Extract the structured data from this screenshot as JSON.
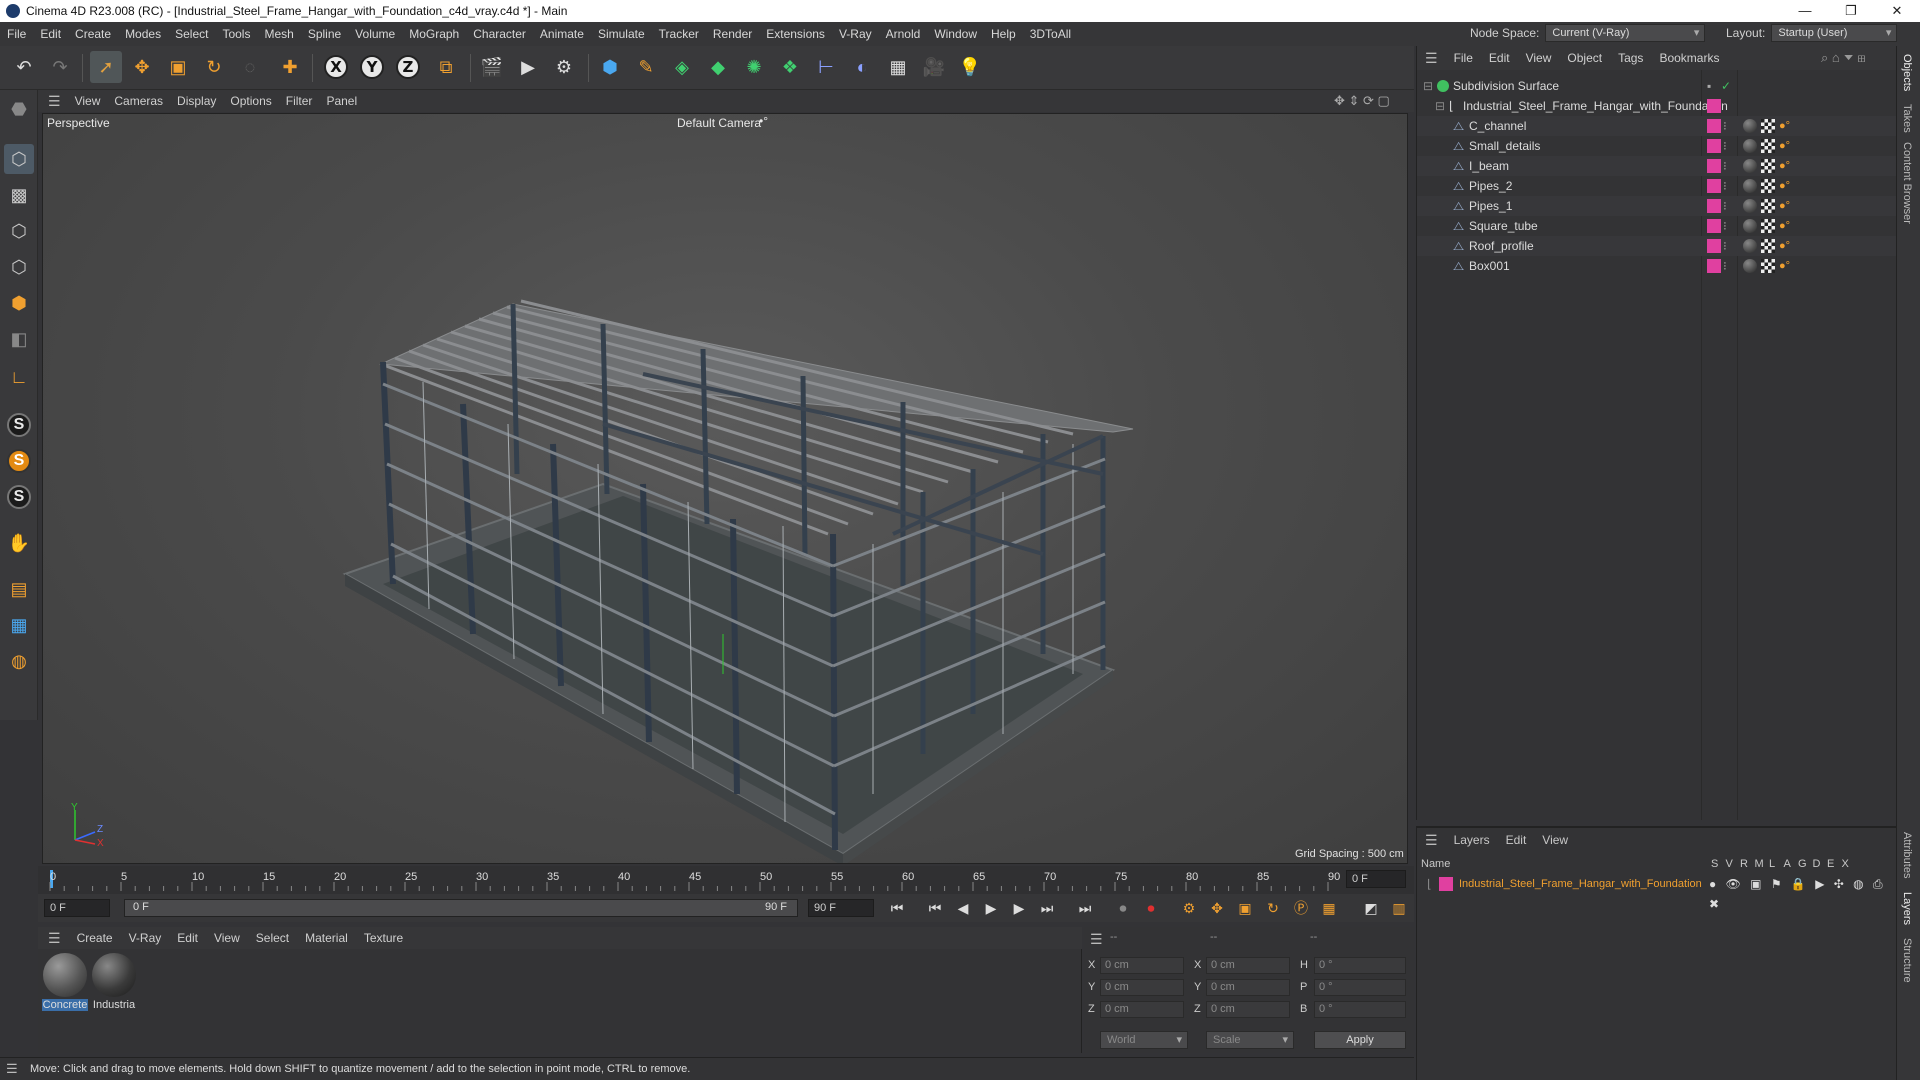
{
  "window": {
    "title": "Cinema 4D R23.008 (RC) - [Industrial_Steel_Frame_Hangar_with_Foundation_c4d_vray.c4d *] - Main",
    "controls": [
      "—",
      "❐",
      "✕"
    ]
  },
  "menubar": {
    "items": [
      "File",
      "Edit",
      "Create",
      "Modes",
      "Select",
      "Tools",
      "Mesh",
      "Spline",
      "Volume",
      "MoGraph",
      "Character",
      "Animate",
      "Simulate",
      "Tracker",
      "Render",
      "Extensions",
      "V-Ray",
      "Arnold",
      "Window",
      "Help",
      "3DToAll"
    ],
    "node_space_label": "Node Space:",
    "node_space_value": "Current (V-Ray)",
    "layout_label": "Layout:",
    "layout_value": "Startup (User)"
  },
  "toolbar": {
    "axis_x": "X",
    "axis_y": "Y",
    "axis_z": "Z"
  },
  "left_tools": {
    "s_labels": [
      "S",
      "S",
      "S"
    ]
  },
  "viewport": {
    "menu": [
      "View",
      "Cameras",
      "Display",
      "Options",
      "Filter",
      "Panel"
    ],
    "view_name": "Perspective",
    "camera": "Default Camera",
    "camera_icon": "•°",
    "grid_spacing": "Grid Spacing : 500 cm",
    "axis_labels": {
      "y": "Y",
      "z": "Z",
      "x": "X"
    }
  },
  "timeline": {
    "ticks": [
      "0",
      "5",
      "10",
      "15",
      "20",
      "25",
      "30",
      "35",
      "40",
      "45",
      "50",
      "55",
      "60",
      "65",
      "70",
      "75",
      "80",
      "85",
      "90"
    ],
    "current_frame": "0 F",
    "start_field": "0 F",
    "range_start": "0 F",
    "range_end": "90 F",
    "end_field": "90 F"
  },
  "material_manager": {
    "menu": [
      "Create",
      "V-Ray",
      "Edit",
      "View",
      "Select",
      "Material",
      "Texture"
    ],
    "materials": [
      {
        "name": "Concrete"
      },
      {
        "name": "Industria"
      }
    ]
  },
  "coordinates": {
    "header": [
      "--",
      "--",
      "--"
    ],
    "rows": [
      {
        "l1": "X",
        "v1": "0 cm",
        "l2": "X",
        "v2": "0 cm",
        "l3": "H",
        "v3": "0 °"
      },
      {
        "l1": "Y",
        "v1": "0 cm",
        "l2": "Y",
        "v2": "0 cm",
        "l3": "P",
        "v3": "0 °"
      },
      {
        "l1": "Z",
        "v1": "0 cm",
        "l2": "Z",
        "v2": "0 cm",
        "l3": "B",
        "v3": "0 °"
      }
    ],
    "space": "World",
    "mode": "Scale",
    "apply": "Apply"
  },
  "status": "Move: Click and drag to move elements. Hold down SHIFT to quantize movement / add to the selection in point mode, CTRL to remove.",
  "object_manager": {
    "menu": [
      "File",
      "Edit",
      "View",
      "Object",
      "Tags",
      "Bookmarks"
    ],
    "root": "Subdivision Surface",
    "group": "Industrial_Steel_Frame_Hangar_with_Foundation",
    "children": [
      "C_channel",
      "Small_details",
      "I_beam",
      "Pipes_2",
      "Pipes_1",
      "Square_tube",
      "Roof_profile",
      "Box001"
    ]
  },
  "layer_manager": {
    "menu": [
      "Layers",
      "Edit",
      "View"
    ],
    "name_header": "Name",
    "flag_headers": [
      "S",
      "V",
      "R",
      "M",
      "L",
      "A",
      "G",
      "D",
      "E",
      "X"
    ],
    "layer_name": "Industrial_Steel_Frame_Hangar_with_Foundation",
    "layer_color": "#e040a0"
  },
  "right_tabs": [
    "Objects",
    "Takes",
    "Content Browser",
    "Attributes",
    "Layers",
    "Structure"
  ],
  "colors": {
    "accent_pink": "#e040a0",
    "layer_text": "#f0a030",
    "axis_y_green": "#2ec82e"
  }
}
